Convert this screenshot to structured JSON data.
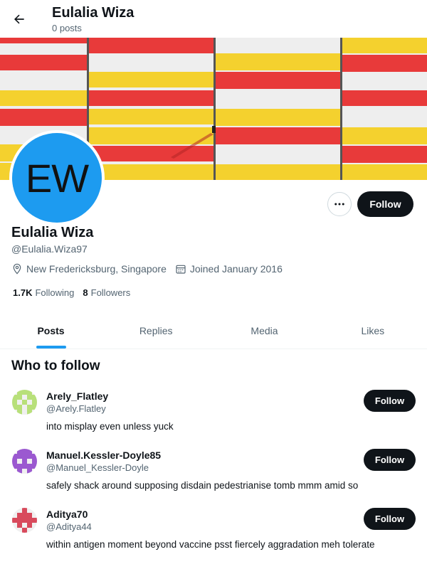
{
  "header": {
    "title": "Eulalia Wiza",
    "subtitle": "0 posts",
    "back_icon": "arrow-left-icon"
  },
  "profile": {
    "avatar_initials": "EW",
    "avatar_color": "#1d9bf0",
    "name": "Eulalia Wiza",
    "handle": "@Eulalia.Wiza97",
    "location": "New Fredericksburg, Singapore",
    "joined": "Joined January 2016",
    "following_count": "1.7K",
    "following_label": "Following",
    "followers_count": "8",
    "followers_label": "Followers",
    "follow_label": "Follow",
    "more_icon": "more-horizontal-icon"
  },
  "tabs": [
    {
      "label": "Posts",
      "active": true
    },
    {
      "label": "Replies",
      "active": false
    },
    {
      "label": "Media",
      "active": false
    },
    {
      "label": "Likes",
      "active": false
    }
  ],
  "who_to_follow": {
    "title": "Who to follow",
    "users": [
      {
        "name": "Arely_Flatley",
        "handle": "@Arely.Flatley",
        "bio": "into misplay even unless yuck",
        "follow_label": "Follow",
        "avatar_color": "#b8e07a"
      },
      {
        "name": "Manuel.Kessler-Doyle85",
        "handle": "@Manuel_Kessler-Doyle",
        "bio": "safely shack around supposing disdain pedestrianise tomb mmm amid so",
        "follow_label": "Follow",
        "avatar_color": "#9b59d0"
      },
      {
        "name": "Aditya70",
        "handle": "@Aditya44",
        "bio": "within antigen moment beyond vaccine psst fiercely aggradation meh tolerate",
        "follow_label": "Follow",
        "avatar_color": "#d84a5c"
      }
    ]
  },
  "colors": {
    "accent": "#1d9bf0",
    "button_dark": "#0f1419",
    "muted": "#536471"
  }
}
